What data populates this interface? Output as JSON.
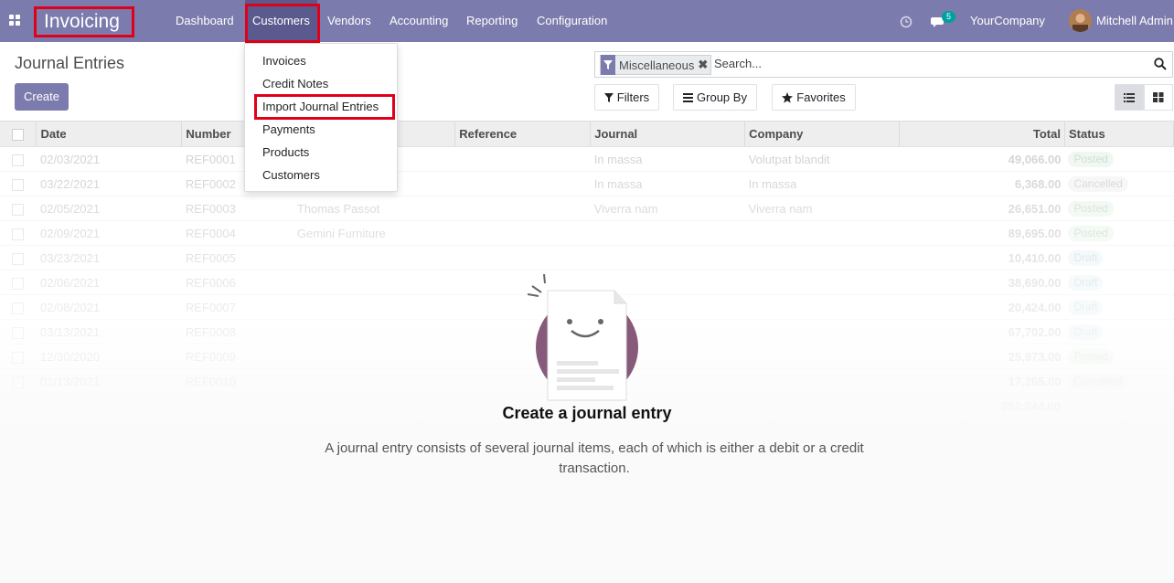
{
  "app": {
    "name": "Invoicing"
  },
  "menu": [
    {
      "label": "Dashboard"
    },
    {
      "label": "Customers"
    },
    {
      "label": "Vendors"
    },
    {
      "label": "Accounting"
    },
    {
      "label": "Reporting"
    },
    {
      "label": "Configuration"
    }
  ],
  "systray": {
    "messages_count": "5",
    "company": "YourCompany",
    "user": "Mitchell Admin"
  },
  "page": {
    "title": "Journal Entries",
    "create_label": "Create"
  },
  "search": {
    "facet_label": "Miscellaneous",
    "placeholder": "Search...",
    "filters_label": "Filters",
    "groupby_label": "Group By",
    "favorites_label": "Favorites"
  },
  "table": {
    "columns": [
      "Date",
      "Number",
      "Partner",
      "Reference",
      "Journal",
      "Company",
      "Total",
      "Status"
    ],
    "rows": [
      {
        "date": "02/03/2021",
        "number": "REF0001",
        "partner": "",
        "reference": "",
        "journal": "In massa",
        "company": "Volutpat blandit",
        "total": "49,066.00",
        "status": "Posted"
      },
      {
        "date": "03/22/2021",
        "number": "REF0002",
        "partner": "",
        "reference": "",
        "journal": "In massa",
        "company": "In massa",
        "total": "6,368.00",
        "status": "Cancelled"
      },
      {
        "date": "02/05/2021",
        "number": "REF0003",
        "partner": "Thomas Passot",
        "reference": "",
        "journal": "Viverra nam",
        "company": "Viverra nam",
        "total": "26,651.00",
        "status": "Posted"
      },
      {
        "date": "02/09/2021",
        "number": "REF0004",
        "partner": "Gemini Furniture",
        "reference": "",
        "journal": "",
        "company": "",
        "total": "89,695.00",
        "status": "Posted"
      },
      {
        "date": "03/23/2021",
        "number": "REF0005",
        "partner": "",
        "reference": "",
        "journal": "",
        "company": "",
        "total": "10,410.00",
        "status": "Draft"
      },
      {
        "date": "02/06/2021",
        "number": "REF0006",
        "partner": "",
        "reference": "",
        "journal": "",
        "company": "",
        "total": "38,690.00",
        "status": "Draft"
      },
      {
        "date": "02/08/2021",
        "number": "REF0007",
        "partner": "",
        "reference": "",
        "journal": "",
        "company": "",
        "total": "20,424.00",
        "status": "Draft"
      },
      {
        "date": "03/13/2021",
        "number": "REF0008",
        "partner": "",
        "reference": "",
        "journal": "",
        "company": "",
        "total": "67,702.00",
        "status": "Draft"
      },
      {
        "date": "12/30/2020",
        "number": "REF0009",
        "partner": "",
        "reference": "",
        "journal": "",
        "company": "",
        "total": "25,973.00",
        "status": "Posted"
      },
      {
        "date": "01/13/2021",
        "number": "REF0010",
        "partner": "",
        "reference": "",
        "journal": "",
        "company": "",
        "total": "17,265.00",
        "status": "Cancelled"
      }
    ],
    "grand_total": "352,244.00"
  },
  "helper": {
    "title": "Create a journal entry",
    "description": "A journal entry consists of several journal items, each of which is either a debit or a credit transaction."
  },
  "dropdown": {
    "items": [
      {
        "label": "Invoices"
      },
      {
        "label": "Credit Notes"
      },
      {
        "label": "Import Journal Entries"
      },
      {
        "label": "Payments"
      },
      {
        "label": "Products"
      },
      {
        "label": "Customers"
      }
    ]
  },
  "colors": {
    "brand": "#7c7bad",
    "highlight": "#e0001a",
    "accent": "#00a09d"
  }
}
